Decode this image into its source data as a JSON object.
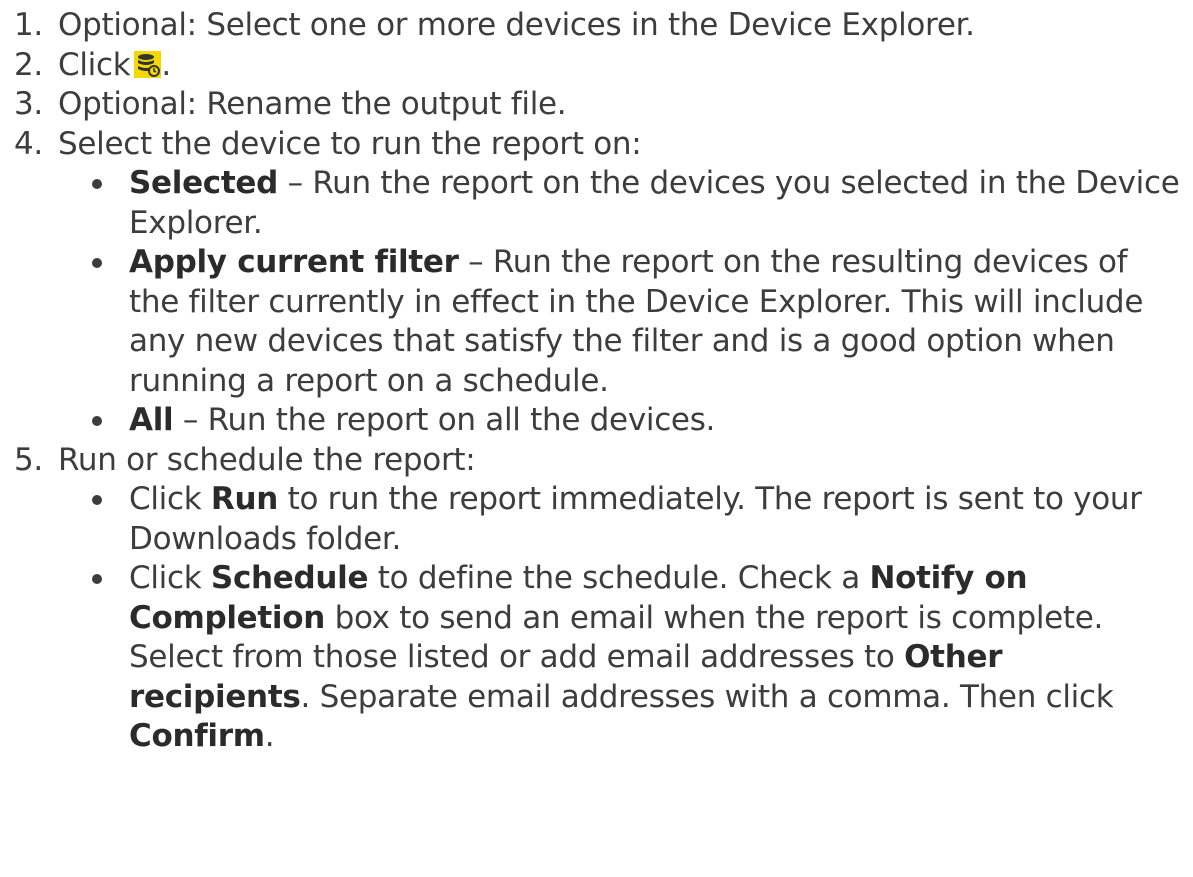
{
  "steps": [
    {
      "num": "1.",
      "text": "Optional: Select one or more devices in the Device Explorer."
    },
    {
      "num": "2.",
      "text_before": "Click",
      "icon": "report-database-icon",
      "text_after": "."
    },
    {
      "num": "3.",
      "text": "Optional: Rename the output file."
    },
    {
      "num": "4.",
      "text": "Select the device to run the report on:",
      "bullets": [
        {
          "bold": "Selected",
          "text": " – Run the report on the devices you selected in the Device Explorer."
        },
        {
          "bold": "Apply current filter",
          "text": " – Run the report on the resulting devices of the filter currently in effect in the Device Explorer. This will include any new devices that satisfy the filter and is a good option when running a report on a schedule."
        },
        {
          "bold": "All",
          "text": " – Run the report on all the devices."
        }
      ]
    },
    {
      "num": "5.",
      "text": "Run or schedule the report:",
      "bullets": [
        {
          "p1": "Click ",
          "b1": "Run",
          "p2": " to run the report immediately. The report is sent to your Downloads folder."
        },
        {
          "p1": "Click ",
          "b1": "Schedule",
          "p2": " to define the schedule. Check a ",
          "b2": "Notify on Completion",
          "p3": " box to send an email when the report is complete. Select from those listed or add email addresses to ",
          "b3": "Other recipients",
          "p4": ". Separate email addresses with a comma. Then click ",
          "b4": "Confirm",
          "p5": "."
        }
      ]
    }
  ],
  "colors": {
    "text": "#3d3d3d",
    "icon_fill": "#f5d800",
    "icon_dark": "#333333"
  }
}
